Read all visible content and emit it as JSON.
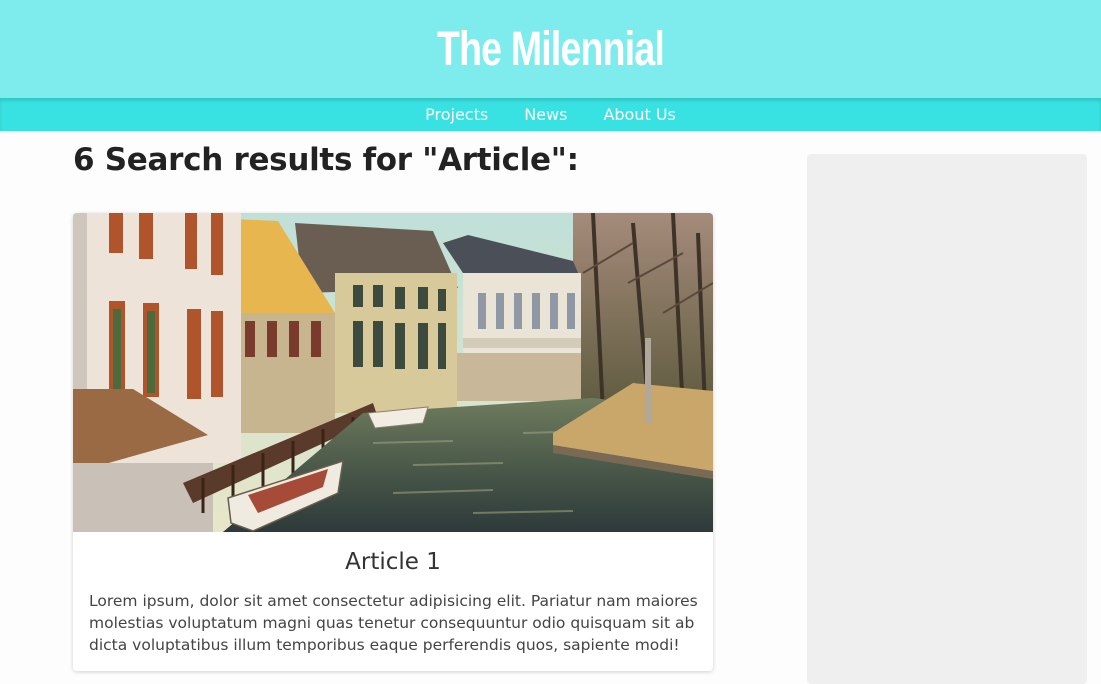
{
  "header": {
    "site_title": "The Milennial"
  },
  "nav": {
    "items": [
      {
        "label": "Projects"
      },
      {
        "label": "News"
      },
      {
        "label": "About Us"
      }
    ]
  },
  "search": {
    "heading": "6 Search results for \"Article\":"
  },
  "articles": [
    {
      "image_alt": "Canal with boats and old houses",
      "title": "Article 1",
      "excerpt": "Lorem ipsum, dolor sit amet consectetur adipisicing elit. Pariatur nam maiores molestias voluptatum magni quas tenetur consequuntur odio quisquam sit ab dicta voluptatibus illum temporibus eaque perferendis quos, sapiente modi!"
    }
  ],
  "colors": {
    "header_bg": "#7eecec",
    "nav_bg": "#39e2e2",
    "sidebar_bg": "#efefef"
  }
}
